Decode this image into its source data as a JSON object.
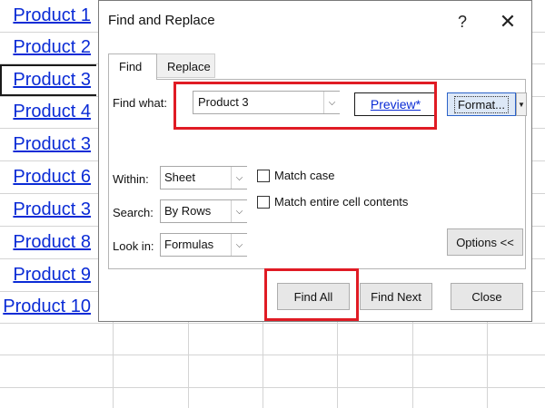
{
  "sheet": {
    "cells": [
      "Product 1",
      "Product 2",
      "Product 3",
      "Product 4",
      "Product 3",
      "Product 6",
      "Product 3",
      "Product 8",
      "Product 9",
      "Product 10"
    ]
  },
  "dialog": {
    "title": "Find and Replace",
    "help_label": "?",
    "close_label": "✕",
    "tabs": [
      {
        "label": "Find"
      },
      {
        "label": "Replace"
      }
    ],
    "find_what": {
      "label": "Find what:",
      "value": "Product 3"
    },
    "preview_label": "Preview*",
    "format_label": "Format...",
    "within": {
      "label": "Within:",
      "value": "Sheet"
    },
    "search": {
      "label": "Search:",
      "value": "By Rows"
    },
    "look_in": {
      "label": "Look in:",
      "value": "Formulas"
    },
    "match_case_label": "Match case",
    "match_entire_label": "Match entire cell contents",
    "options_label": "Options <<",
    "find_all_label": "Find All",
    "find_next_label": "Find Next",
    "close_button_label": "Close"
  },
  "colors": {
    "highlight": "#e01b24",
    "link": "#0a2bd6"
  }
}
